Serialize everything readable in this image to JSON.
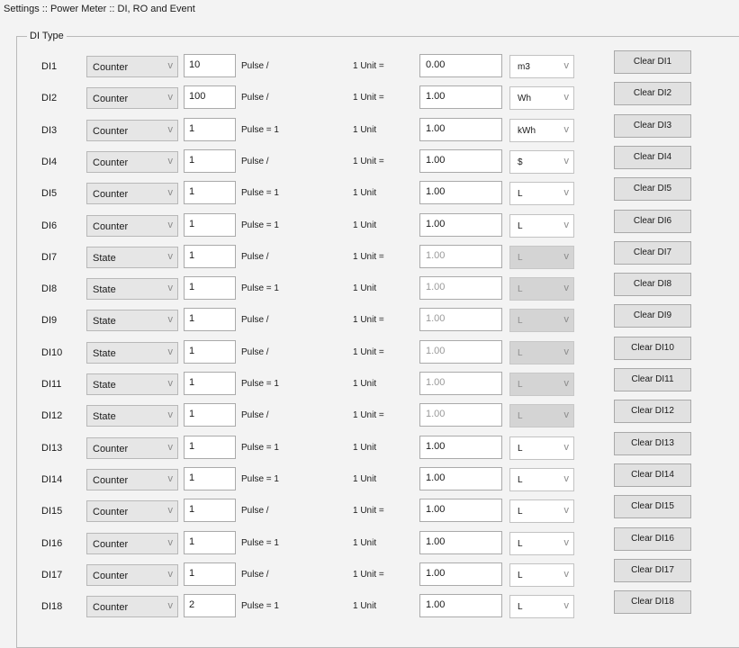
{
  "breadcrumb": "Settings :: Power Meter :: DI, RO and Event",
  "group_title": "DI Type",
  "chevron_glyph": "v",
  "rows": [
    {
      "di": "DI1",
      "type": "Counter",
      "pulse": "10",
      "pulse_label": "Pulse   /",
      "unit_label": "1 Unit =",
      "factor": "0.00",
      "unit": "m3",
      "unit_disabled": false,
      "clear": "Clear DI1"
    },
    {
      "di": "DI2",
      "type": "Counter",
      "pulse": "100",
      "pulse_label": "Pulse   /",
      "unit_label": "1 Unit =",
      "factor": "1.00",
      "unit": "Wh",
      "unit_disabled": false,
      "clear": "Clear DI2"
    },
    {
      "di": "DI3",
      "type": "Counter",
      "pulse": "1",
      "pulse_label": "Pulse = 1",
      "unit_label": "1 Unit",
      "factor": "1.00",
      "unit": "kWh",
      "unit_disabled": false,
      "clear": "Clear DI3"
    },
    {
      "di": "DI4",
      "type": "Counter",
      "pulse": "1",
      "pulse_label": "Pulse   /",
      "unit_label": "1 Unit =",
      "factor": "1.00",
      "unit": "$",
      "unit_disabled": false,
      "clear": "Clear DI4"
    },
    {
      "di": "DI5",
      "type": "Counter",
      "pulse": "1",
      "pulse_label": "Pulse = 1",
      "unit_label": "1 Unit",
      "factor": "1.00",
      "unit": "L",
      "unit_disabled": false,
      "clear": "Clear DI5"
    },
    {
      "di": "DI6",
      "type": "Counter",
      "pulse": "1",
      "pulse_label": "Pulse = 1",
      "unit_label": "1 Unit",
      "factor": "1.00",
      "unit": "L",
      "unit_disabled": false,
      "clear": "Clear DI6"
    },
    {
      "di": "DI7",
      "type": "State",
      "pulse": "1",
      "pulse_label": "Pulse   /",
      "unit_label": "1 Unit =",
      "factor": "1.00",
      "unit": "L",
      "unit_disabled": true,
      "clear": "Clear DI7"
    },
    {
      "di": "DI8",
      "type": "State",
      "pulse": "1",
      "pulse_label": "Pulse = 1",
      "unit_label": "1 Unit",
      "factor": "1.00",
      "unit": "L",
      "unit_disabled": true,
      "clear": "Clear DI8"
    },
    {
      "di": "DI9",
      "type": "State",
      "pulse": "1",
      "pulse_label": "Pulse   /",
      "unit_label": "1 Unit =",
      "factor": "1.00",
      "unit": "L",
      "unit_disabled": true,
      "clear": "Clear DI9"
    },
    {
      "di": "DI10",
      "type": "State",
      "pulse": "1",
      "pulse_label": "Pulse   /",
      "unit_label": "1 Unit =",
      "factor": "1.00",
      "unit": "L",
      "unit_disabled": true,
      "clear": "Clear DI10"
    },
    {
      "di": "DI11",
      "type": "State",
      "pulse": "1",
      "pulse_label": "Pulse = 1",
      "unit_label": "1 Unit",
      "factor": "1.00",
      "unit": "L",
      "unit_disabled": true,
      "clear": "Clear DI11"
    },
    {
      "di": "DI12",
      "type": "State",
      "pulse": "1",
      "pulse_label": "Pulse   /",
      "unit_label": "1 Unit =",
      "factor": "1.00",
      "unit": "L",
      "unit_disabled": true,
      "clear": "Clear DI12"
    },
    {
      "di": "DI13",
      "type": "Counter",
      "pulse": "1",
      "pulse_label": "Pulse = 1",
      "unit_label": "1 Unit",
      "factor": "1.00",
      "unit": "L",
      "unit_disabled": false,
      "clear": "Clear DI13"
    },
    {
      "di": "DI14",
      "type": "Counter",
      "pulse": "1",
      "pulse_label": "Pulse = 1",
      "unit_label": "1 Unit",
      "factor": "1.00",
      "unit": "L",
      "unit_disabled": false,
      "clear": "Clear DI14"
    },
    {
      "di": "DI15",
      "type": "Counter",
      "pulse": "1",
      "pulse_label": "Pulse   /",
      "unit_label": "1 Unit =",
      "factor": "1.00",
      "unit": "L",
      "unit_disabled": false,
      "clear": "Clear DI15"
    },
    {
      "di": "DI16",
      "type": "Counter",
      "pulse": "1",
      "pulse_label": "Pulse = 1",
      "unit_label": "1 Unit",
      "factor": "1.00",
      "unit": "L",
      "unit_disabled": false,
      "clear": "Clear DI16"
    },
    {
      "di": "DI17",
      "type": "Counter",
      "pulse": "1",
      "pulse_label": "Pulse   /",
      "unit_label": "1 Unit =",
      "factor": "1.00",
      "unit": "L",
      "unit_disabled": false,
      "clear": "Clear DI17"
    },
    {
      "di": "DI18",
      "type": "Counter",
      "pulse": "2",
      "pulse_label": "Pulse = 1",
      "unit_label": "1 Unit",
      "factor": "1.00",
      "unit": "L",
      "unit_disabled": false,
      "clear": "Clear DI18"
    }
  ]
}
